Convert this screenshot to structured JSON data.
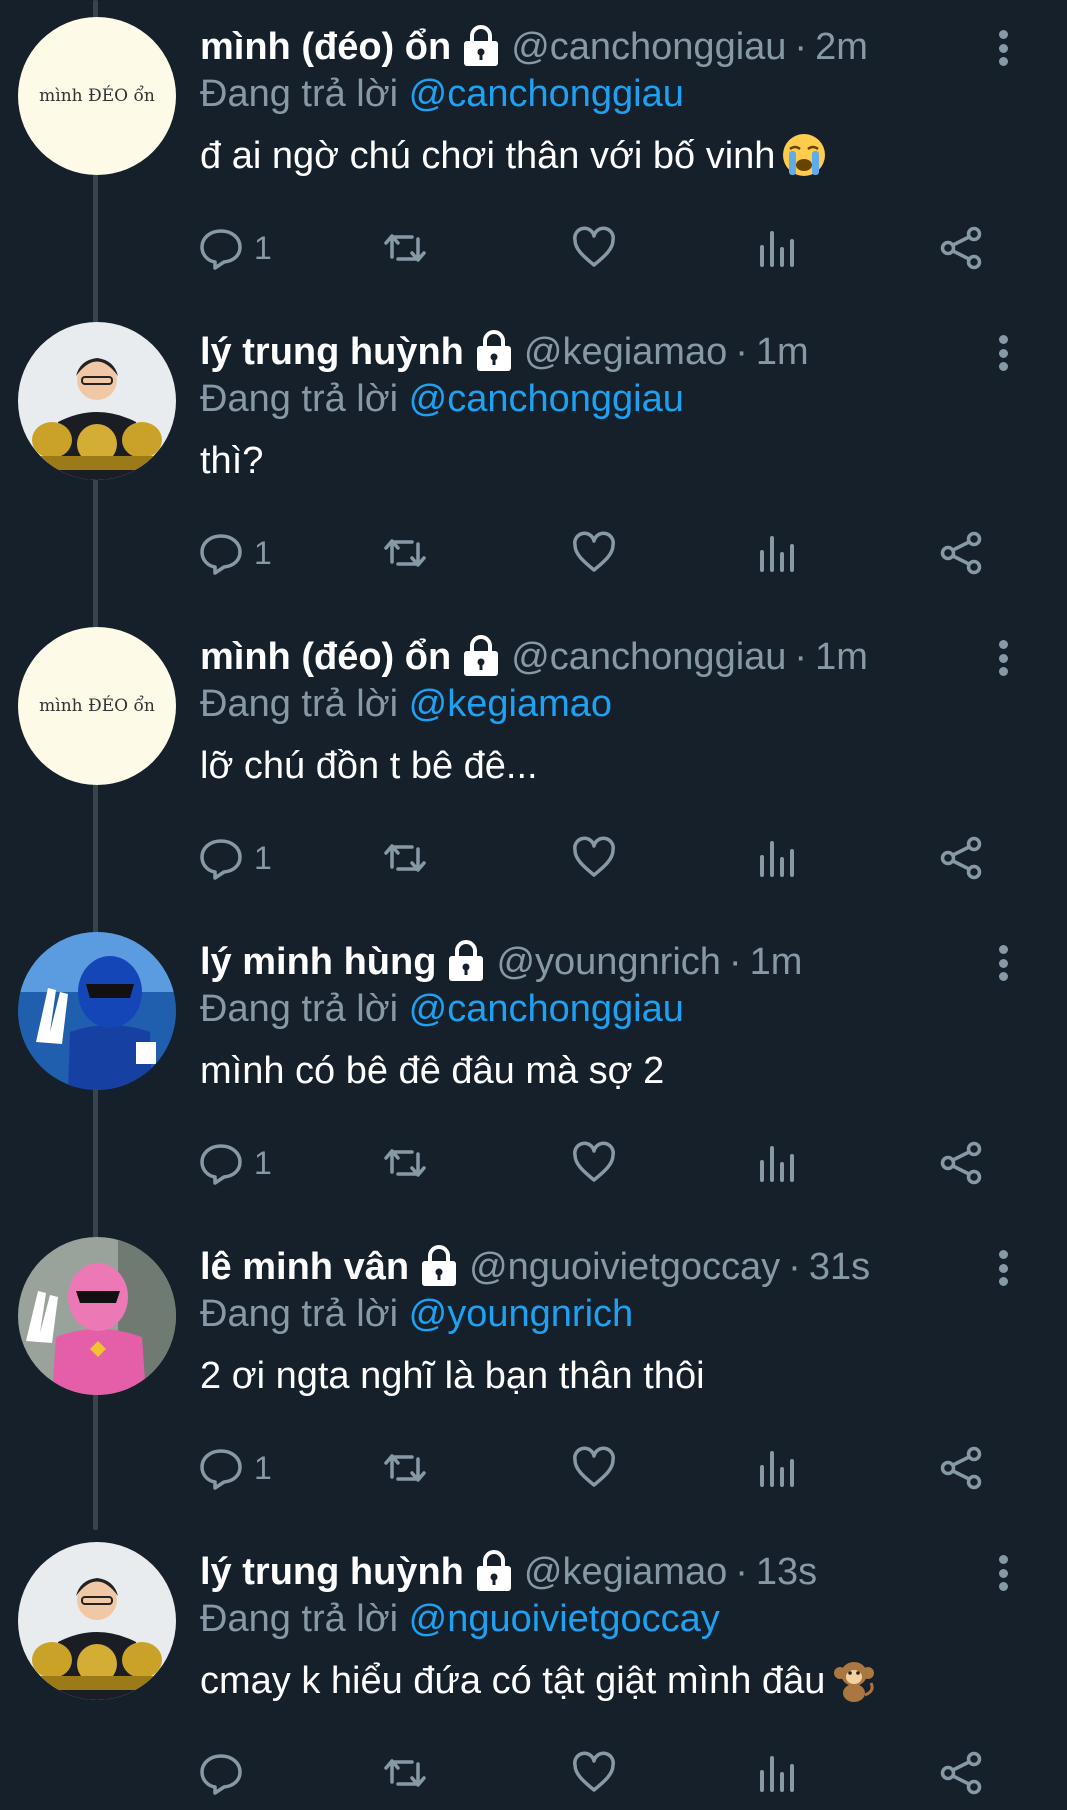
{
  "tweets": [
    {
      "name": "mình (đéo) ổn",
      "handle": "@canchonggiau",
      "time": "2m",
      "replying_label": "Đang trả lời",
      "replying_to": "@canchonggiau",
      "text": "đ ai ngờ chú chơi thân với bố vinh",
      "emoji": "loudly-crying-face",
      "reply_count": "1",
      "avatar": "text-avatar",
      "avatar_text": "mình ĐÉO ổn"
    },
    {
      "name": "lý trung huỳnh",
      "handle": "@kegiamao",
      "time": "1m",
      "replying_label": "Đang trả lời",
      "replying_to": "@canchonggiau",
      "text": "thì?",
      "emoji": "",
      "reply_count": "1",
      "avatar": "person-with-trophies"
    },
    {
      "name": "mình (đéo) ổn",
      "handle": "@canchonggiau",
      "time": "1m",
      "replying_label": "Đang trả lời",
      "replying_to": "@kegiamao",
      "text": "lỡ chú đồn t bê đê...",
      "emoji": "",
      "reply_count": "1",
      "avatar": "text-avatar",
      "avatar_text": "mình ĐÉO ổn"
    },
    {
      "name": "lý minh hùng",
      "handle": "@youngnrich",
      "time": "1m",
      "replying_label": "Đang trả lời",
      "replying_to": "@canchonggiau",
      "text": "mình có bê đê đâu mà sợ 2",
      "emoji": "",
      "reply_count": "1",
      "avatar": "blue-ranger"
    },
    {
      "name": "lê minh vân",
      "handle": "@nguoivietgoccay",
      "time": "31s",
      "replying_label": "Đang trả lời",
      "replying_to": "@youngnrich",
      "text": "2 ơi ngta nghĩ là bạn thân thôi",
      "emoji": "",
      "reply_count": "1",
      "avatar": "pink-ranger"
    },
    {
      "name": "lý trung huỳnh",
      "handle": "@kegiamao",
      "time": "13s",
      "replying_label": "Đang trả lời",
      "replying_to": "@nguoivietgoccay",
      "text": "cmay k hiểu đứa có tật giật mình đâu",
      "emoji": "monkey",
      "reply_count": "",
      "avatar": "person-with-trophies"
    }
  ],
  "colors": {
    "background": "#15202b",
    "secondary_text": "#8899a6",
    "link": "#1da1f2",
    "thread_line": "#38444d"
  }
}
